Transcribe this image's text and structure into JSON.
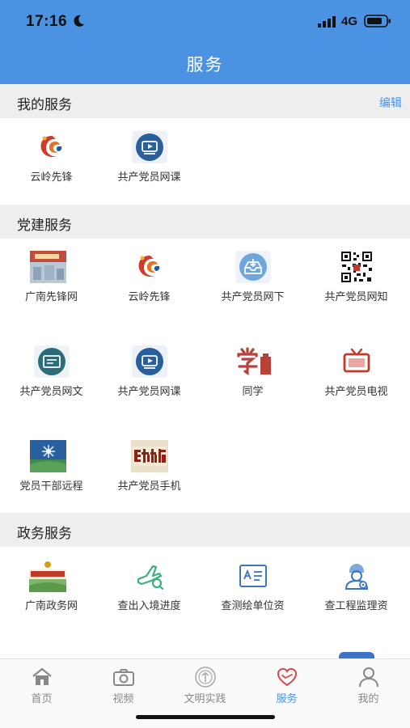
{
  "status_bar": {
    "time": "17:16",
    "network": "4G"
  },
  "header": {
    "title": "服务"
  },
  "my_services": {
    "title": "我的服务",
    "edit_label": "编辑",
    "items": [
      {
        "label": "云岭先锋",
        "icon": "yunling-logo-icon"
      },
      {
        "label": "共产党员网课",
        "icon": "video-course-icon"
      }
    ]
  },
  "party_services": {
    "title": "党建服务",
    "items": [
      {
        "label": "广南先锋网",
        "icon": "guangnan-site-thumbnail-icon"
      },
      {
        "label": "云岭先锋",
        "icon": "yunling-logo-icon"
      },
      {
        "label": "共产党员网下",
        "icon": "download-tray-icon"
      },
      {
        "label": "共产党员网知",
        "icon": "qr-code-icon"
      },
      {
        "label": "共产党员网文",
        "icon": "document-screen-icon"
      },
      {
        "label": "共产党员网课",
        "icon": "video-course-icon"
      },
      {
        "label": "同学",
        "icon": "xue-character-icon"
      },
      {
        "label": "共产党员电视",
        "icon": "tv-icon"
      },
      {
        "label": "党员干部远程",
        "icon": "remote-education-icon"
      },
      {
        "label": "共产党员手机",
        "icon": "mobile-newspaper-icon"
      }
    ]
  },
  "gov_services": {
    "title": "政务服务",
    "items": [
      {
        "label": "广南政务网",
        "icon": "gov-site-thumbnail-icon"
      },
      {
        "label": "查出入境进度",
        "icon": "airplane-search-icon"
      },
      {
        "label": "查测绘单位资",
        "icon": "survey-document-icon"
      },
      {
        "label": "查工程监理资",
        "icon": "engineer-icon"
      }
    ]
  },
  "tab_bar": {
    "tabs": [
      {
        "label": "首页",
        "icon": "home-icon"
      },
      {
        "label": "视频",
        "icon": "camera-icon"
      },
      {
        "label": "文明实践",
        "icon": "civilization-icon"
      },
      {
        "label": "服务",
        "icon": "heart-hands-icon"
      },
      {
        "label": "我的",
        "icon": "person-icon"
      }
    ],
    "active": "服务"
  },
  "colors": {
    "accent": "#4b93e2",
    "party_red": "#c0392b",
    "section_bg": "#eeeeee"
  }
}
